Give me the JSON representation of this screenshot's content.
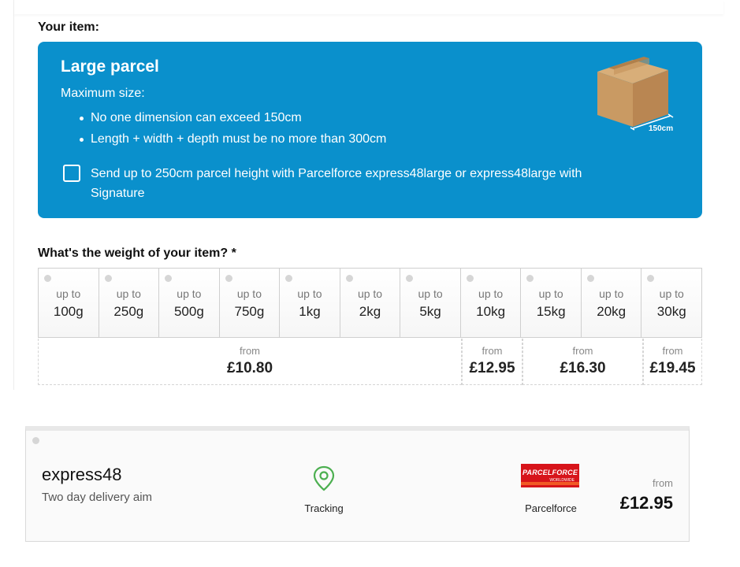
{
  "item_heading": "Your item:",
  "parcel": {
    "title": "Large parcel",
    "max_size_label": "Maximum size:",
    "rules": [
      "No one dimension can exceed 150cm",
      "Length + width + depth must be no more than 300cm"
    ],
    "option_label": "Send up to 250cm parcel height with Parcelforce express48large or express48large with Signature",
    "option_checked": false,
    "box_dimension": "150cm",
    "panel_color": "#0a90cc"
  },
  "weight": {
    "question": "What's the weight of your item? *",
    "options": [
      {
        "prefix": "up to",
        "value": "100g"
      },
      {
        "prefix": "up to",
        "value": "250g"
      },
      {
        "prefix": "up to",
        "value": "500g"
      },
      {
        "prefix": "up to",
        "value": "750g"
      },
      {
        "prefix": "up to",
        "value": "1kg"
      },
      {
        "prefix": "up to",
        "value": "2kg"
      },
      {
        "prefix": "up to",
        "value": "5kg"
      },
      {
        "prefix": "up to",
        "value": "10kg"
      },
      {
        "prefix": "up to",
        "value": "15kg"
      },
      {
        "prefix": "up to",
        "value": "20kg"
      },
      {
        "prefix": "up to",
        "value": "30kg"
      }
    ],
    "prices": [
      {
        "from": "from",
        "price": "£10.80"
      },
      {
        "from": "from",
        "price": "£12.95"
      },
      {
        "from": "from",
        "price": "£16.30"
      },
      {
        "from": "from",
        "price": "£19.45"
      }
    ]
  },
  "service": {
    "name": "express48",
    "description": "Two day delivery aim",
    "feature_icon": "location-pin-icon",
    "feature_label": "Tracking",
    "carrier_logo_text": "PARCELFORCE",
    "carrier_logo_sub": "WORLDWIDE",
    "carrier": "Parcelforce",
    "from": "from",
    "price": "£12.95",
    "accent": "#4caf50"
  }
}
